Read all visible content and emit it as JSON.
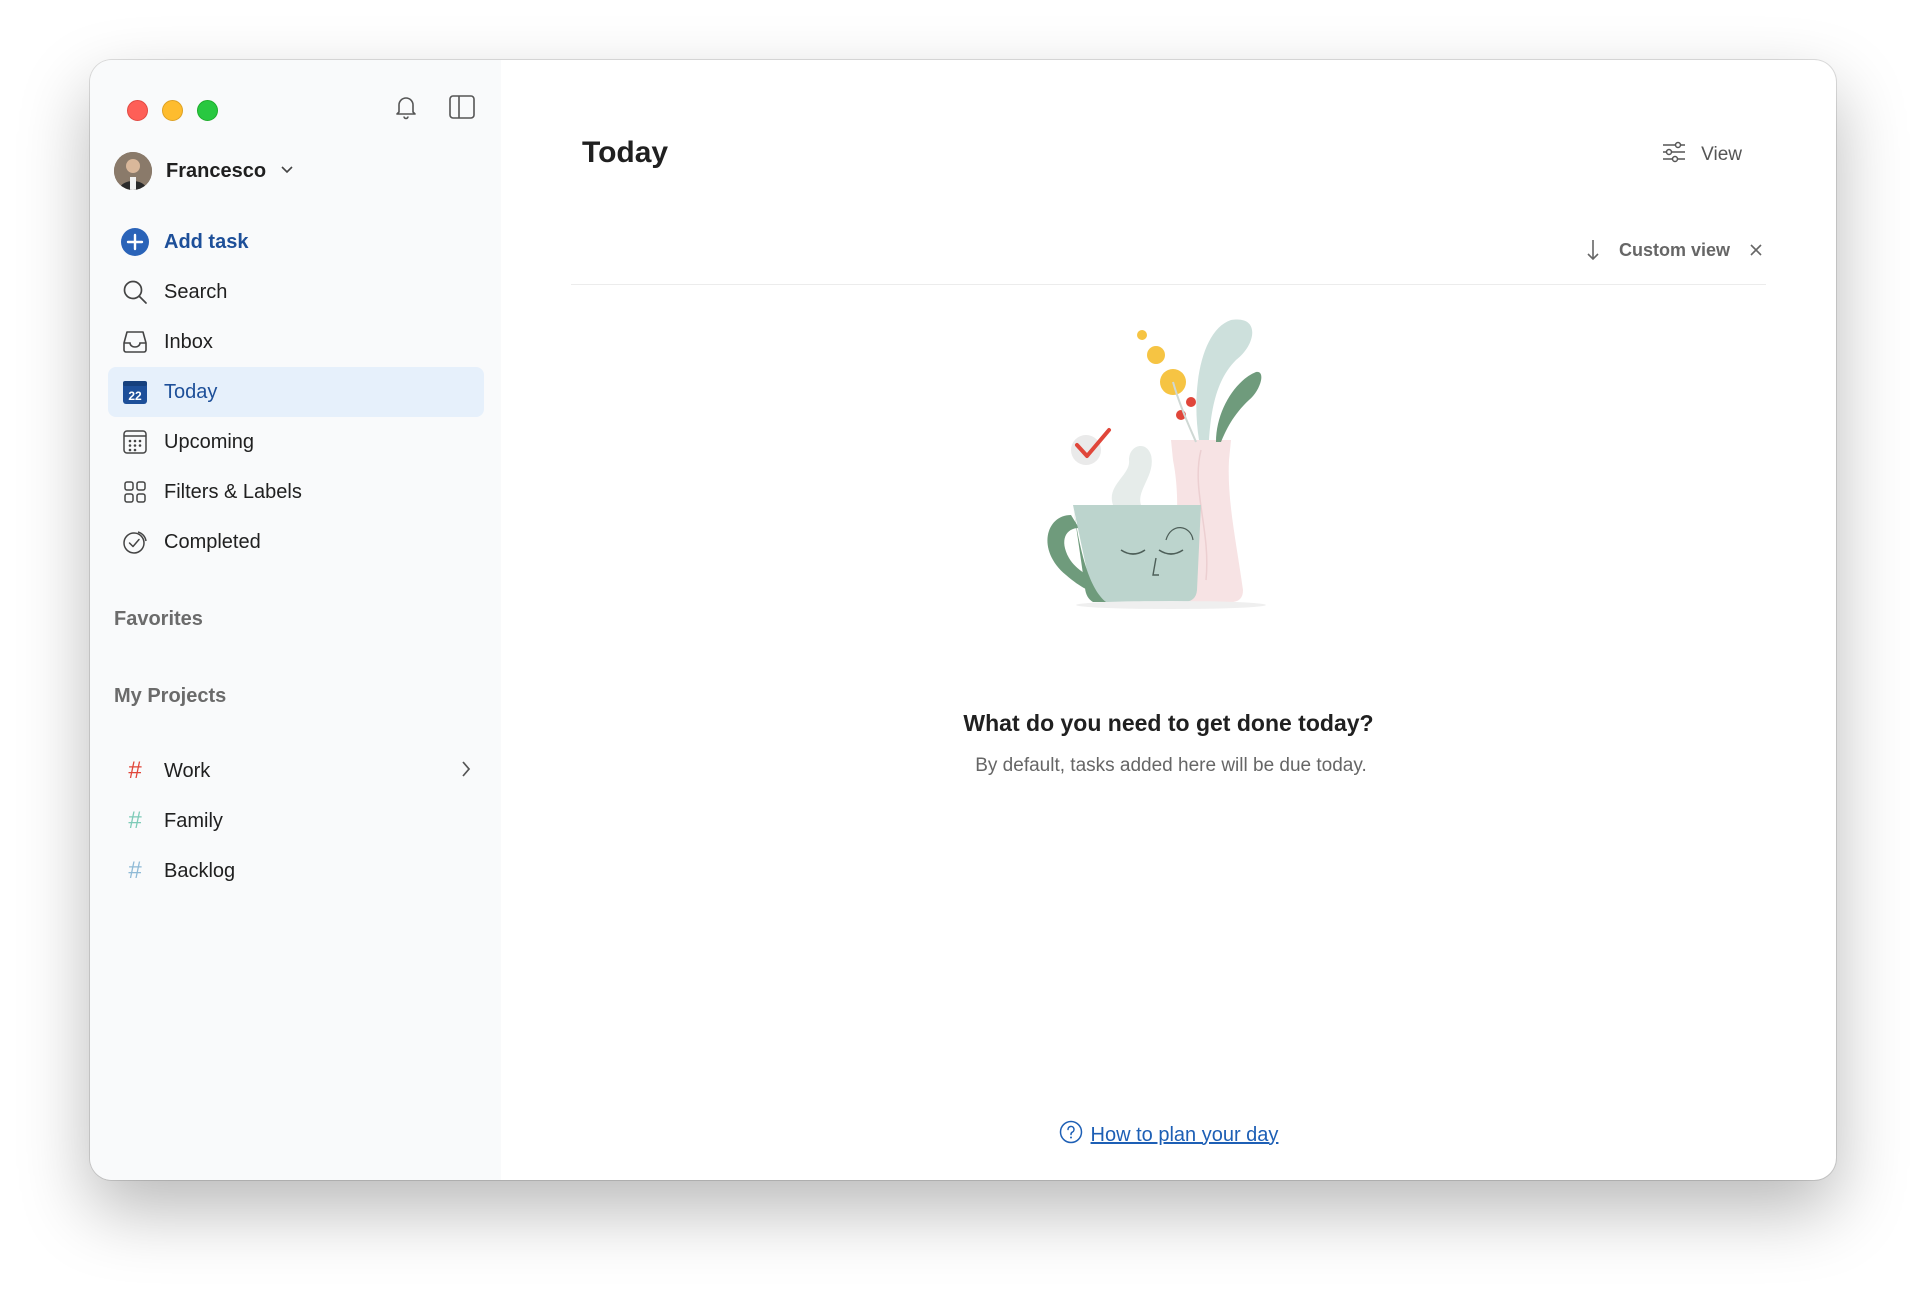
{
  "window": {
    "traffic_lights": [
      "close",
      "minimize",
      "zoom"
    ]
  },
  "sidebar": {
    "user": {
      "name": "Francesco"
    },
    "add_task_label": "Add task",
    "nav": [
      {
        "label": "Search",
        "icon": "search-icon"
      },
      {
        "label": "Inbox",
        "icon": "inbox-icon"
      },
      {
        "label": "Today",
        "icon": "calendar-today-icon",
        "badge": "22",
        "active": true
      },
      {
        "label": "Upcoming",
        "icon": "calendar-grid-icon"
      },
      {
        "label": "Filters & Labels",
        "icon": "grid-icon"
      },
      {
        "label": "Completed",
        "icon": "check-circle-icon"
      }
    ],
    "favorites_title": "Favorites",
    "projects_title": "My Projects",
    "projects": [
      {
        "label": "Work",
        "color": "#e0463a",
        "has_children": true
      },
      {
        "label": "Family",
        "color": "#7ecbb8"
      },
      {
        "label": "Backlog",
        "color": "#8fbad6"
      }
    ]
  },
  "main": {
    "title": "Today",
    "view_label": "View",
    "custom_view_label": "Custom view",
    "empty_title": "What do you need to get done today?",
    "empty_subtitle": "By default, tasks added here will be due today.",
    "help_link": "How to plan your day"
  },
  "colors": {
    "accent": "#1d4f99",
    "active_bg": "#e6f0fb",
    "sidebar_bg": "#f9fafb"
  }
}
